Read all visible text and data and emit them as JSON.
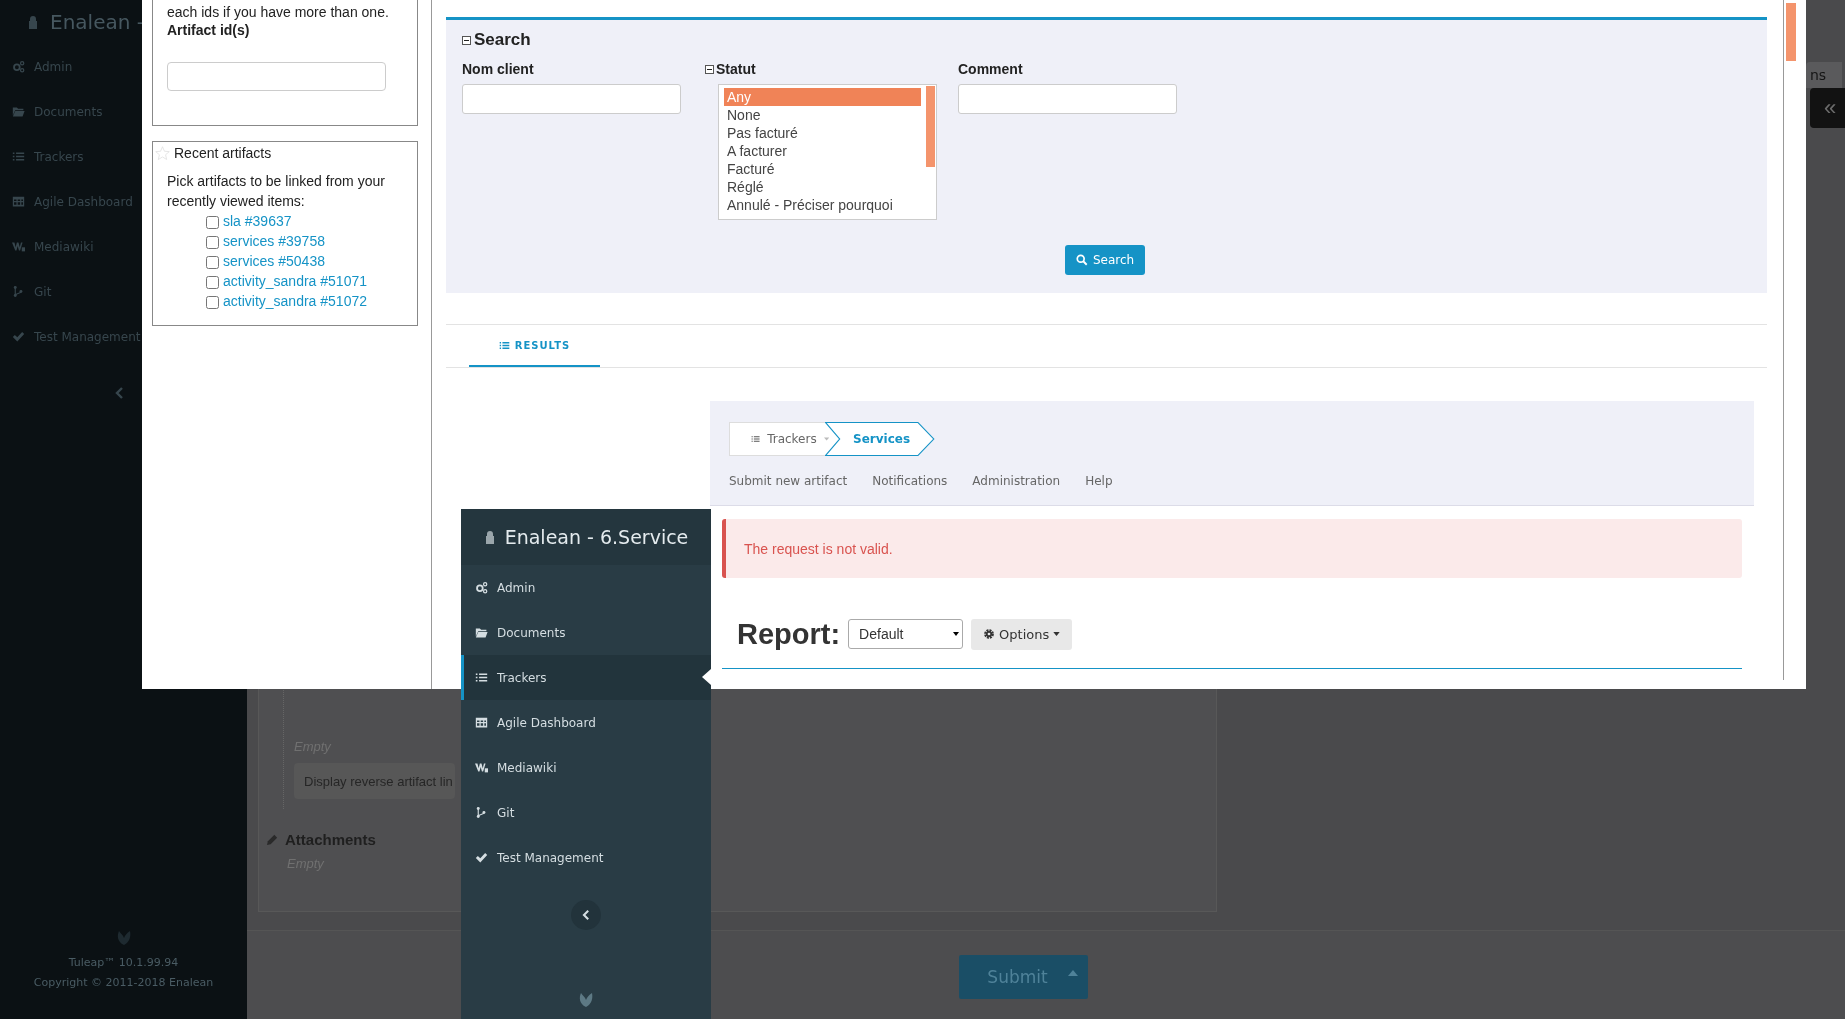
{
  "background_page": {
    "sidebar": {
      "title": "Enalean -",
      "items": [
        {
          "label": "Admin"
        },
        {
          "label": "Documents"
        },
        {
          "label": "Trackers"
        },
        {
          "label": "Agile Dashboard"
        },
        {
          "label": "Mediawiki"
        },
        {
          "label": "Git"
        },
        {
          "label": "Test Management"
        }
      ],
      "footer": {
        "version": "Tuleap™ 10.1.99.94",
        "copyright": "Copyright © 2011-2018 Enalean"
      }
    },
    "artifact_links": {
      "empty_text": "Empty",
      "reverse_button": "Display reverse artifact lin"
    },
    "attachments": {
      "title": "Attachments",
      "empty_text": "Empty"
    },
    "submit_button": "Submit",
    "tab_fragment": "ns",
    "expand_button": "«"
  },
  "modal": {
    "artifact_ids": {
      "hint": "each ids if you have more than one.",
      "label": "Artifact id(s)"
    },
    "recent_artifacts": {
      "title": "Recent artifacts",
      "intro": "Pick artifacts to be linked from your recently viewed items:",
      "items": [
        {
          "label": "sla #39637",
          "checked": false
        },
        {
          "label": "services #39758",
          "checked": false
        },
        {
          "label": "services #50438",
          "checked": false
        },
        {
          "label": "activity_sandra #51071",
          "checked": false
        },
        {
          "label": "activity_sandra #51072",
          "checked": false
        }
      ]
    },
    "search": {
      "title": "Search",
      "fields": [
        {
          "kind": "text",
          "label": "Nom client"
        },
        {
          "kind": "listbox",
          "label": "Statut",
          "options": [
            {
              "label": "Any",
              "selected": true
            },
            {
              "label": "None",
              "selected": false
            },
            {
              "label": "Pas facturé",
              "selected": false
            },
            {
              "label": "A facturer",
              "selected": false
            },
            {
              "label": "Facturé",
              "selected": false
            },
            {
              "label": "Réglé",
              "selected": false
            },
            {
              "label": "Annulé - Préciser pourquoi",
              "selected": false
            }
          ]
        },
        {
          "kind": "text",
          "label": "Comment"
        }
      ],
      "button": "Search"
    },
    "tabs": [
      {
        "label": "RESULTS",
        "selected": true
      }
    ],
    "tracker_page": {
      "breadcrumb": [
        {
          "label": "Trackers",
          "selected": false
        },
        {
          "label": "Services",
          "selected": true
        }
      ],
      "links": [
        "Submit new artifact",
        "Notifications",
        "Administration",
        "Help"
      ],
      "alert": "The request is not valid.",
      "report": {
        "label": "Report:",
        "select_value": "Default",
        "options_button": "Options"
      }
    },
    "sidebar": {
      "title": "Enalean - 6.Service",
      "items": [
        {
          "label": "Admin",
          "selected": false
        },
        {
          "label": "Documents",
          "selected": false
        },
        {
          "label": "Trackers",
          "selected": true
        },
        {
          "label": "Agile Dashboard",
          "selected": false
        },
        {
          "label": "Mediawiki",
          "selected": false
        },
        {
          "label": "Git",
          "selected": false
        },
        {
          "label": "Test Management",
          "selected": false
        }
      ]
    }
  }
}
